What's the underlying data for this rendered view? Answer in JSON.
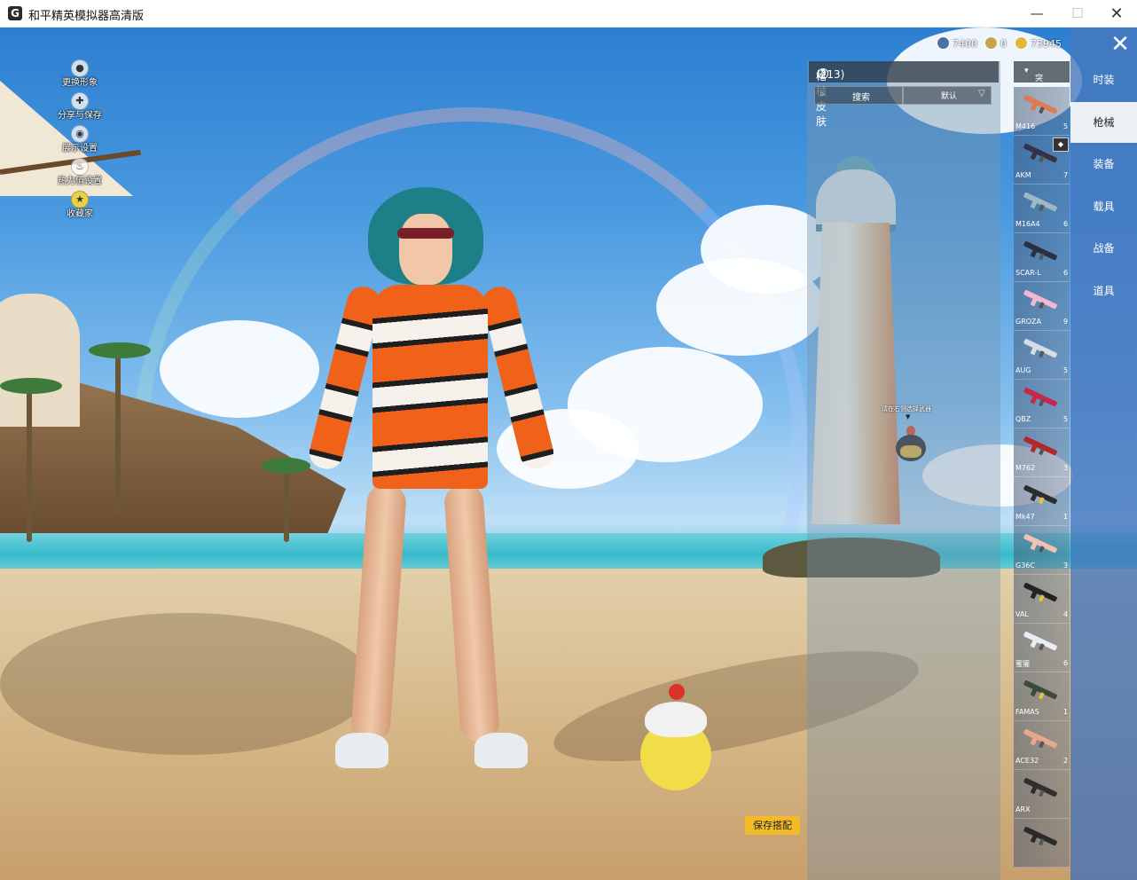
{
  "window": {
    "title": "和平精英模拟器高清版"
  },
  "quick_menu": [
    {
      "label": "更换形象",
      "icon": "person-icon"
    },
    {
      "label": "分享与保存",
      "icon": "share-icon"
    },
    {
      "label": "展示设置",
      "icon": "eye-icon"
    },
    {
      "label": "热力值设置",
      "icon": "flame-icon"
    },
    {
      "label": "收藏家",
      "icon": "collector-icon"
    }
  ],
  "currency": [
    {
      "value": "7400",
      "icon": "coupon-icon",
      "color": "#4d6fa8"
    },
    {
      "value": "0",
      "icon": "badge-icon",
      "color": "#c7a64a"
    },
    {
      "value": "73945",
      "icon": "gold-coin-icon",
      "color": "#e0b83a"
    }
  ],
  "skin_panel": {
    "title": "枪械皮肤",
    "count": "(213)",
    "search_label": "搜索",
    "sort_label": "默认",
    "hint": "请在右侧选择武器"
  },
  "category_dropdown": {
    "selected": "突击步枪"
  },
  "weapons": [
    {
      "name": "M416",
      "count": "5",
      "color": "#e07a55"
    },
    {
      "name": "AKM",
      "count": "7",
      "color": "#333344"
    },
    {
      "name": "M16A4",
      "count": "6",
      "color": "#9fb8c6"
    },
    {
      "name": "SCAR-L",
      "count": "6",
      "color": "#2a3040"
    },
    {
      "name": "GROZA",
      "count": "9",
      "color": "#f3b8cf"
    },
    {
      "name": "AUG",
      "count": "5",
      "color": "#d8dde2"
    },
    {
      "name": "QBZ",
      "count": "5",
      "color": "#c8264a"
    },
    {
      "name": "M762",
      "count": "3",
      "color": "#b3262b"
    },
    {
      "name": "Mk47",
      "count": "1",
      "color": "#2d2d2d"
    },
    {
      "name": "G36C",
      "count": "3",
      "color": "#f1c1b5"
    },
    {
      "name": "VAL",
      "count": "4",
      "color": "#222222"
    },
    {
      "name": "蜜獾",
      "count": "6",
      "color": "#e8eef4"
    },
    {
      "name": "FAMAS",
      "count": "1",
      "color": "#3d4a3a"
    },
    {
      "name": "ACE32",
      "count": "2",
      "color": "#e7a88a"
    },
    {
      "name": "ARX",
      "count": "",
      "color": "#2f2f2f"
    },
    {
      "name": "",
      "count": "",
      "color": "#2a2a2a"
    }
  ],
  "nav": {
    "items": [
      "时装",
      "枪械",
      "装备",
      "载具",
      "战备",
      "道具"
    ],
    "active": "枪械"
  },
  "save_button": "保存搭配"
}
